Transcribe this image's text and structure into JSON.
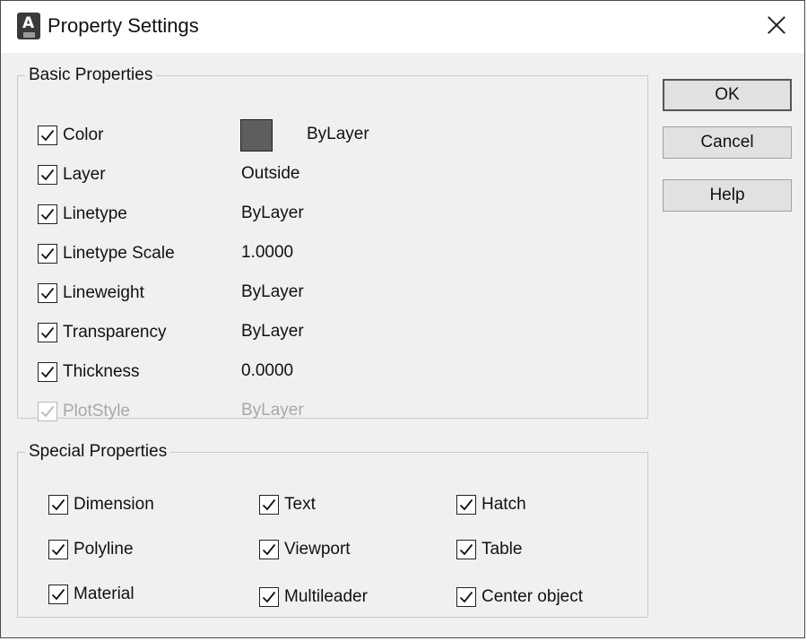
{
  "window": {
    "title": "Property Settings"
  },
  "basic": {
    "legend": "Basic Properties",
    "items": [
      {
        "label": "Color",
        "value": "ByLayer",
        "checked": true,
        "enabled": true,
        "swatch_color": "#5e5e5e"
      },
      {
        "label": "Layer",
        "value": "Outside",
        "checked": true,
        "enabled": true
      },
      {
        "label": "Linetype",
        "value": "ByLayer",
        "checked": true,
        "enabled": true
      },
      {
        "label": "Linetype Scale",
        "value": "1.0000",
        "checked": true,
        "enabled": true
      },
      {
        "label": "Lineweight",
        "value": "ByLayer",
        "checked": true,
        "enabled": true
      },
      {
        "label": "Transparency",
        "value": "ByLayer",
        "checked": true,
        "enabled": true
      },
      {
        "label": "Thickness",
        "value": "0.0000",
        "checked": true,
        "enabled": true
      },
      {
        "label": "PlotStyle",
        "value": "ByLayer",
        "checked": true,
        "enabled": false
      }
    ]
  },
  "special": {
    "legend": "Special Properties",
    "items": [
      {
        "label": "Dimension",
        "checked": true
      },
      {
        "label": "Text",
        "checked": true
      },
      {
        "label": "Hatch",
        "checked": true
      },
      {
        "label": "Polyline",
        "checked": true
      },
      {
        "label": "Viewport",
        "checked": true
      },
      {
        "label": "Table",
        "checked": true
      },
      {
        "label": "Material",
        "checked": true
      },
      {
        "label": "Multileader",
        "checked": true
      },
      {
        "label": "Center object",
        "checked": true
      }
    ]
  },
  "buttons": {
    "ok": "OK",
    "cancel": "Cancel",
    "help": "Help"
  }
}
